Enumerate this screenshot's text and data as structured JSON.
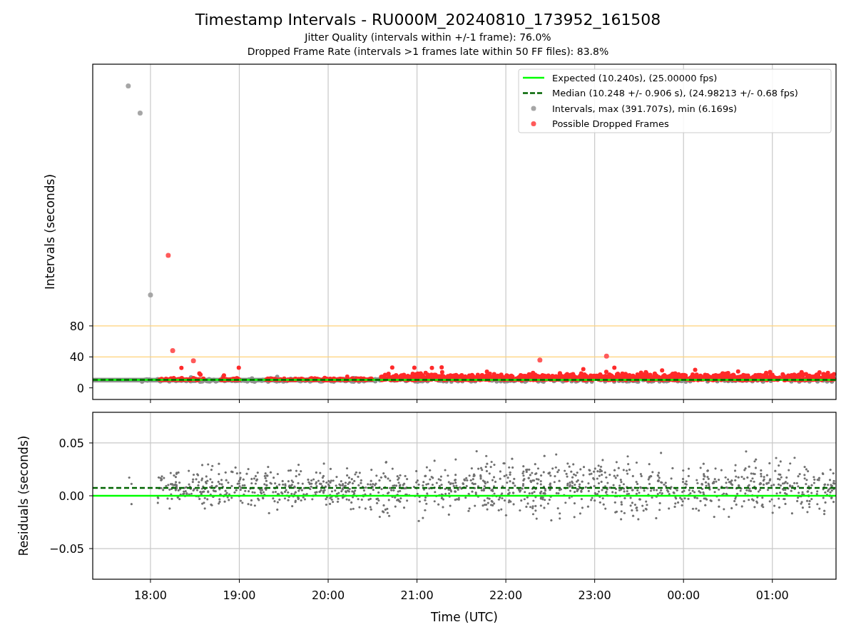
{
  "figure": {
    "title": "Timestamp Intervals - RU000M_20240810_173952_161508",
    "subtitles": [
      "Jitter Quality (intervals within +/-1 frame): 76.0%",
      "Dropped Frame Rate (intervals >1 frames late within 50 FF files): 83.8%"
    ]
  },
  "charts": [
    {
      "chart_data": {
        "type": "scatter",
        "ylabel": "Intervals (seconds)",
        "xlim": [
          "2024-08-10 17:21",
          "2024-08-11 01:43"
        ],
        "ylim": [
          -15,
          418
        ],
        "yticks": [
          0,
          40,
          80
        ],
        "grid": true,
        "legend": true,
        "ref_lines": [
          {
            "axis": "y",
            "value": 10.24,
            "label": "Expected (10.240s), (25.00000 fps)",
            "color": "#00ff00"
          },
          {
            "axis": "y",
            "value": 10.248,
            "label": "Median (10.248 +/- 0.906 s), (24.98213 +/- 0.68 fps)",
            "color": "#006400"
          }
        ],
        "series": [
          {
            "name": "Intervals, max (391.707s), min (6.169s)",
            "color": "#a6a6a6",
            "x": [
              "2024-08-10 17:45",
              "2024-08-10 17:53",
              "2024-08-10 18:00"
            ],
            "values": [
              390,
              355,
              120
            ]
          },
          {
            "name": "Possible Dropped Frames",
            "color": "#ff5a5a",
            "x": [
              "2024-08-10 18:12",
              "2024-08-10 18:15",
              "2024-08-10 23:08",
              "2024-08-10 22:23",
              "2024-08-10 18:29"
            ],
            "values": [
              171,
              48,
              41,
              36,
              35
            ]
          }
        ]
      }
    },
    {
      "chart_data": {
        "type": "scatter",
        "xlabel": "Time (UTC)",
        "ylabel": "Residuals (seconds)",
        "xlim": [
          "2024-08-10 17:21",
          "2024-08-11 01:43"
        ],
        "ylim": [
          -0.079,
          0.079
        ],
        "grid": true,
        "xticks": [
          {
            "value": "2024-08-10 18:00",
            "label": "18:00"
          },
          {
            "value": "2024-08-10 19:00",
            "label": "19:00"
          },
          {
            "value": "2024-08-10 20:00",
            "label": "20:00"
          },
          {
            "value": "2024-08-10 21:00",
            "label": "21:00"
          },
          {
            "value": "2024-08-10 22:00",
            "label": "22:00"
          },
          {
            "value": "2024-08-10 23:00",
            "label": "23:00"
          },
          {
            "value": "2024-08-11 00:00",
            "label": "00:00"
          },
          {
            "value": "2024-08-11 01:00",
            "label": "01:00"
          }
        ],
        "yticks": [
          {
            "value": 0.05,
            "label": "0.05"
          },
          {
            "value": 0,
            "label": "0.00"
          },
          {
            "value": -0.05,
            "label": "−0.05"
          }
        ],
        "ref_lines": [
          {
            "axis": "y",
            "value": 0,
            "color": "#00ff00"
          },
          {
            "axis": "y",
            "value": 0.0075,
            "color": "#006400"
          }
        ]
      }
    }
  ]
}
